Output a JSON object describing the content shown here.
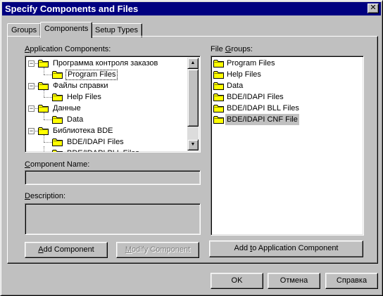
{
  "window": {
    "title": "Specify Components and Files"
  },
  "tabs": [
    {
      "label": "Groups",
      "active": false
    },
    {
      "label": "Components",
      "active": true
    },
    {
      "label": "Setup Types",
      "active": false
    }
  ],
  "components": {
    "label_prefix": "",
    "label_accel": "A",
    "label_rest": "pplication Components:",
    "tree": [
      {
        "label": "Программа контроля заказов",
        "level": 0,
        "expanded": true
      },
      {
        "label": "Program Files",
        "level": 1,
        "selected": true
      },
      {
        "label": "Файлы справки",
        "level": 0,
        "expanded": true
      },
      {
        "label": "Help Files",
        "level": 1
      },
      {
        "label": "Данные",
        "level": 0,
        "expanded": true
      },
      {
        "label": "Data",
        "level": 1
      },
      {
        "label": "Библиотека BDE",
        "level": 0,
        "expanded": true
      },
      {
        "label": "BDE/IDAPI Files",
        "level": 1
      },
      {
        "label": "BDE/IDAPI BLL Files",
        "level": 1
      }
    ]
  },
  "component_name": {
    "label_prefix": "",
    "label_accel": "C",
    "label_rest": "omponent Name:",
    "value": ""
  },
  "description": {
    "label_prefix": "",
    "label_accel": "D",
    "label_rest": "escription:",
    "value": ""
  },
  "file_groups": {
    "label_prefix": "File ",
    "label_accel": "G",
    "label_rest": "roups:",
    "items": [
      {
        "label": "Program Files"
      },
      {
        "label": "Help Files"
      },
      {
        "label": "Data"
      },
      {
        "label": "BDE/IDAPI Files"
      },
      {
        "label": "BDE/IDAPI BLL Files"
      },
      {
        "label": "BDE/IDAPI CNF File",
        "highlighted": true
      }
    ]
  },
  "buttons": {
    "add_component": {
      "prefix": "",
      "accel": "A",
      "rest": "dd Component"
    },
    "modify_component": {
      "prefix": "",
      "accel": "M",
      "rest": "odify Component"
    },
    "add_to_app": {
      "prefix": "Add ",
      "accel": "t",
      "rest": "o Application Component"
    },
    "ok": "OK",
    "cancel": "Отмена",
    "help": "Справка"
  },
  "icons": {
    "close": "close-icon",
    "folder": "folder-icon",
    "scroll_up": "arrow-up-icon",
    "scroll_down": "arrow-down-icon"
  },
  "colors": {
    "titlebar": "#000080",
    "face": "#c0c0c0",
    "folder_fill": "#ffff00"
  }
}
